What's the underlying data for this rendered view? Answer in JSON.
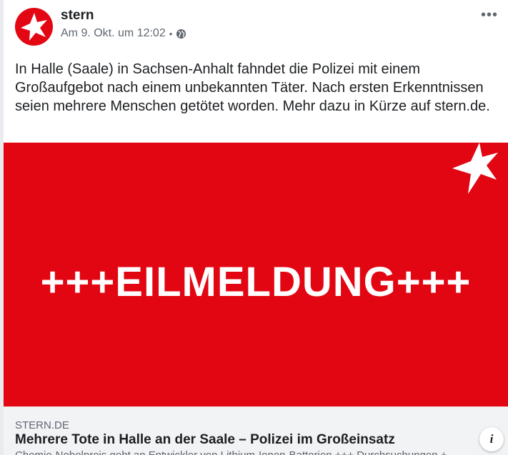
{
  "post": {
    "page_name": "stern",
    "timestamp": "Am 9. Okt. um 12:02",
    "separator": "•",
    "privacy_icon": "globe-icon",
    "more_label": "•••",
    "text": "In Halle (Saale) in Sachsen-Anhalt fahndet die Polizei mit einem Großaufgebot nach einem unbekannten Täter. Nach ersten Erkenntnissen seien mehrere Menschen getötet worden. Mehr dazu in Kürze auf stern.de."
  },
  "hero": {
    "headline": "+++EILMELDUNG+++",
    "background": "#e20613",
    "logo_icon": "stern-star-icon"
  },
  "link": {
    "domain": "STERN.DE",
    "title": "Mehrere Tote in Halle an der Saale – Polizei im Großeinsatz",
    "description": "Chemie-Nobelpreis geht an Entwickler von Lithium-Ionen-Batterien +++ Durchsuchungen +",
    "info_label": "i"
  },
  "colors": {
    "brand_red": "#e30613",
    "text": "#1c1e21",
    "secondary_text": "#606770"
  }
}
